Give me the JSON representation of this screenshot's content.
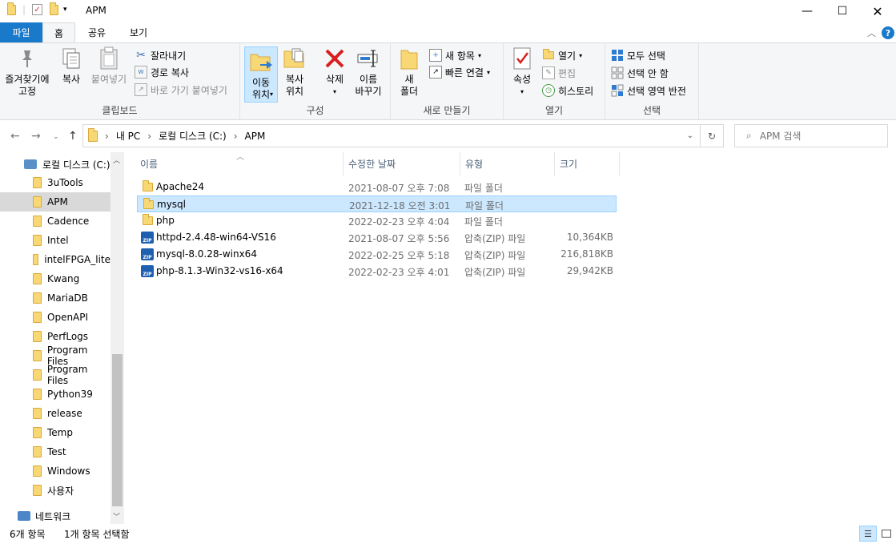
{
  "window": {
    "title": "APM"
  },
  "ribbon_tabs": [
    "파일",
    "홈",
    "공유",
    "보기"
  ],
  "ribbon": {
    "clipboard": {
      "label": "클립보드",
      "pin": "즐겨찾기에\n고정",
      "copy": "복사",
      "paste": "붙여넣기",
      "cut": "잘라내기",
      "copy_path": "경로 복사",
      "paste_shortcut": "바로 가기 붙여넣기"
    },
    "organize": {
      "label": "구성",
      "move_to": "이동\n위치",
      "copy_to": "복사\n위치",
      "delete": "삭제",
      "rename": "이름\n바꾸기"
    },
    "new": {
      "label": "새로 만들기",
      "new_folder": "새\n폴더",
      "new_item": "새 항목",
      "easy_access": "빠른 연결"
    },
    "open": {
      "label": "열기",
      "properties": "속성",
      "open": "열기",
      "edit": "편집",
      "history": "히스토리"
    },
    "select": {
      "label": "선택",
      "select_all": "모두 선택",
      "select_none": "선택 안 함",
      "invert": "선택 영역 반전"
    }
  },
  "address": {
    "path": [
      "내 PC",
      "로컬 디스크 (C:)",
      "APM"
    ],
    "search_placeholder": "APM 검색"
  },
  "nav": {
    "drive": "로컬 디스크 (C:)",
    "folders": [
      "3uTools",
      "APM",
      "Cadence",
      "Intel",
      "intelFPGA_lite",
      "Kwang",
      "MariaDB",
      "OpenAPI",
      "PerfLogs",
      "Program Files",
      "Program Files",
      "Python39",
      "release",
      "Temp",
      "Test",
      "Windows",
      "사용자"
    ],
    "selected": "APM",
    "network": "네트워크"
  },
  "columns": [
    "이름",
    "수정한 날짜",
    "유형",
    "크기"
  ],
  "files": [
    {
      "name": "Apache24",
      "date": "2021-08-07 오후 7:08",
      "type": "파일 폴더",
      "size": "",
      "kind": "folder"
    },
    {
      "name": "mysql",
      "date": "2021-12-18 오전 3:01",
      "type": "파일 폴더",
      "size": "",
      "kind": "folder",
      "selected": true
    },
    {
      "name": "php",
      "date": "2022-02-23 오후 4:04",
      "type": "파일 폴더",
      "size": "",
      "kind": "folder"
    },
    {
      "name": "httpd-2.4.48-win64-VS16",
      "date": "2021-08-07 오후 5:56",
      "type": "압축(ZIP) 파일",
      "size": "10,364KB",
      "kind": "zip"
    },
    {
      "name": "mysql-8.0.28-winx64",
      "date": "2022-02-25 오후 5:18",
      "type": "압축(ZIP) 파일",
      "size": "216,818KB",
      "kind": "zip"
    },
    {
      "name": "php-8.1.3-Win32-vs16-x64",
      "date": "2022-02-23 오후 4:01",
      "type": "압축(ZIP) 파일",
      "size": "29,942KB",
      "kind": "zip"
    }
  ],
  "status": {
    "count": "6개 항목",
    "selected": "1개 항목 선택함"
  }
}
